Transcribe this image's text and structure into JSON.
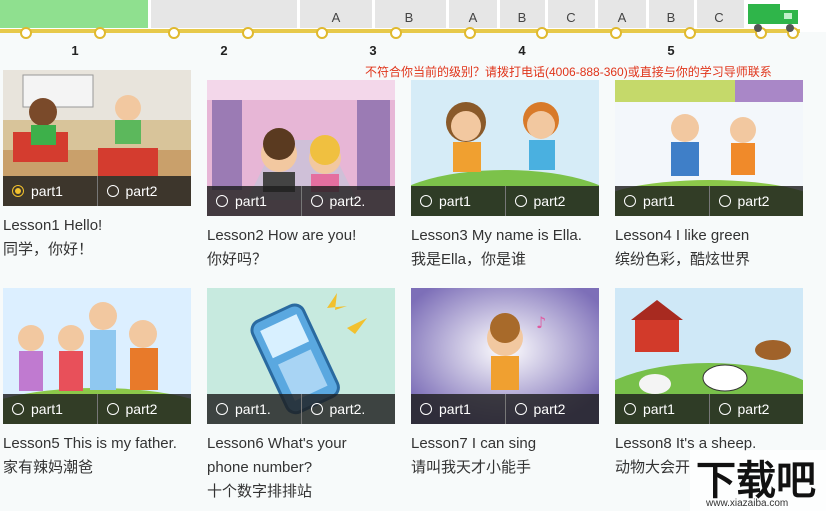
{
  "progress": {
    "levels": [
      "1",
      "2",
      "3",
      "4",
      "5"
    ],
    "sublabels": [
      "A",
      "B",
      "A",
      "B",
      "C",
      "A",
      "B",
      "C"
    ]
  },
  "notice": "不符合你当前的级别？请拨打电话(4006-888-360)或直接与你的学习导师联系",
  "lessons": [
    {
      "title": "Lesson1 Hello!",
      "subtitle": "同学，你好！",
      "part1": "part1",
      "part2": "part2",
      "selected": "part1"
    },
    {
      "title": "Lesson2 How are you!",
      "subtitle": "你好吗？",
      "part1": "part1",
      "part2": "part2.",
      "selected": ""
    },
    {
      "title": "Lesson3 My name is Ella.",
      "subtitle": "我是Ella，你是谁",
      "part1": "part1",
      "part2": "part2",
      "selected": ""
    },
    {
      "title": "Lesson4 I like green",
      "subtitle": "缤纷色彩，酷炫世界",
      "part1": "part1",
      "part2": "part2",
      "selected": ""
    },
    {
      "title": "Lesson5 This is my father.",
      "subtitle": "家有辣妈潮爸",
      "part1": "part1",
      "part2": "part2",
      "selected": ""
    },
    {
      "title": "Lesson6 What's your phone number?",
      "subtitle": "十个数字排排站",
      "part1": "part1.",
      "part2": "part2.",
      "selected": ""
    },
    {
      "title": "Lesson7 I can sing",
      "subtitle": "请叫我天才小能手",
      "part1": "part1",
      "part2": "part2",
      "selected": ""
    },
    {
      "title": "Lesson8 It's a sheep.",
      "subtitle": "动物大会开",
      "part1": "part1",
      "part2": "part2",
      "selected": ""
    }
  ],
  "watermark": {
    "text": "www.xiazaiba.com"
  },
  "colors": {
    "accent": "#f2c12e",
    "notice": "#e0341a",
    "progress_done": "#8fe08f"
  }
}
